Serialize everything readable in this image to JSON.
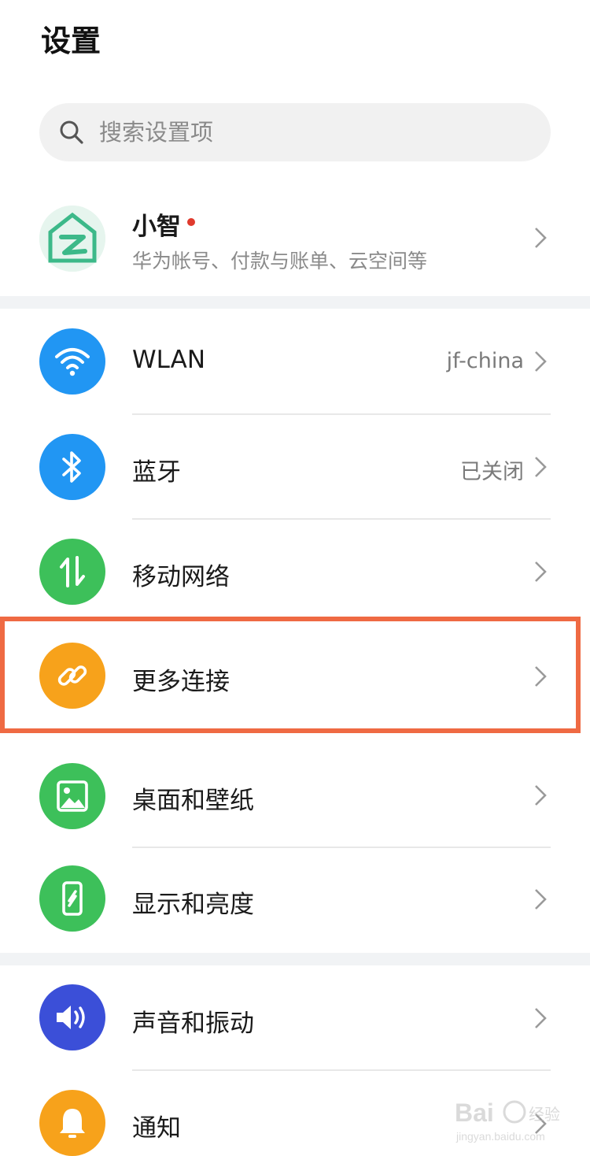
{
  "header": {
    "title": "设置"
  },
  "search": {
    "placeholder": "搜索设置项",
    "icon": "search-icon"
  },
  "account": {
    "name": "小智",
    "has_notification_dot": true,
    "subtitle": "华为帐号、付款与账单、云空间等",
    "avatar_color": "#3cb989"
  },
  "settings": {
    "wlan": {
      "label": "WLAN",
      "value": "jf-china",
      "icon": "wifi-icon",
      "color": "#2196f3"
    },
    "bluetooth": {
      "label": "蓝牙",
      "value": "已关闭",
      "icon": "bluetooth-icon",
      "color": "#2196f3"
    },
    "mobile_network": {
      "label": "移动网络",
      "icon": "mobile-data-icon",
      "color": "#3dc05a"
    },
    "more_connections": {
      "label": "更多连接",
      "icon": "link-icon",
      "color": "#f7a21b",
      "highlighted": true
    },
    "wallpaper": {
      "label": "桌面和壁纸",
      "icon": "image-icon",
      "color": "#3dc05a"
    },
    "display": {
      "label": "显示和亮度",
      "icon": "phone-brightness-icon",
      "color": "#3dc05a"
    },
    "sound": {
      "label": "声音和振动",
      "icon": "speaker-icon",
      "color": "#3b4fd8"
    },
    "notifications": {
      "label": "通知",
      "icon": "bell-icon",
      "color": "#f7a21b"
    }
  },
  "highlight_color": "#ef6a43",
  "watermark": {
    "brand": "Bai",
    "brand_suffix": "经验",
    "url": "jingyan.baidu.com"
  }
}
